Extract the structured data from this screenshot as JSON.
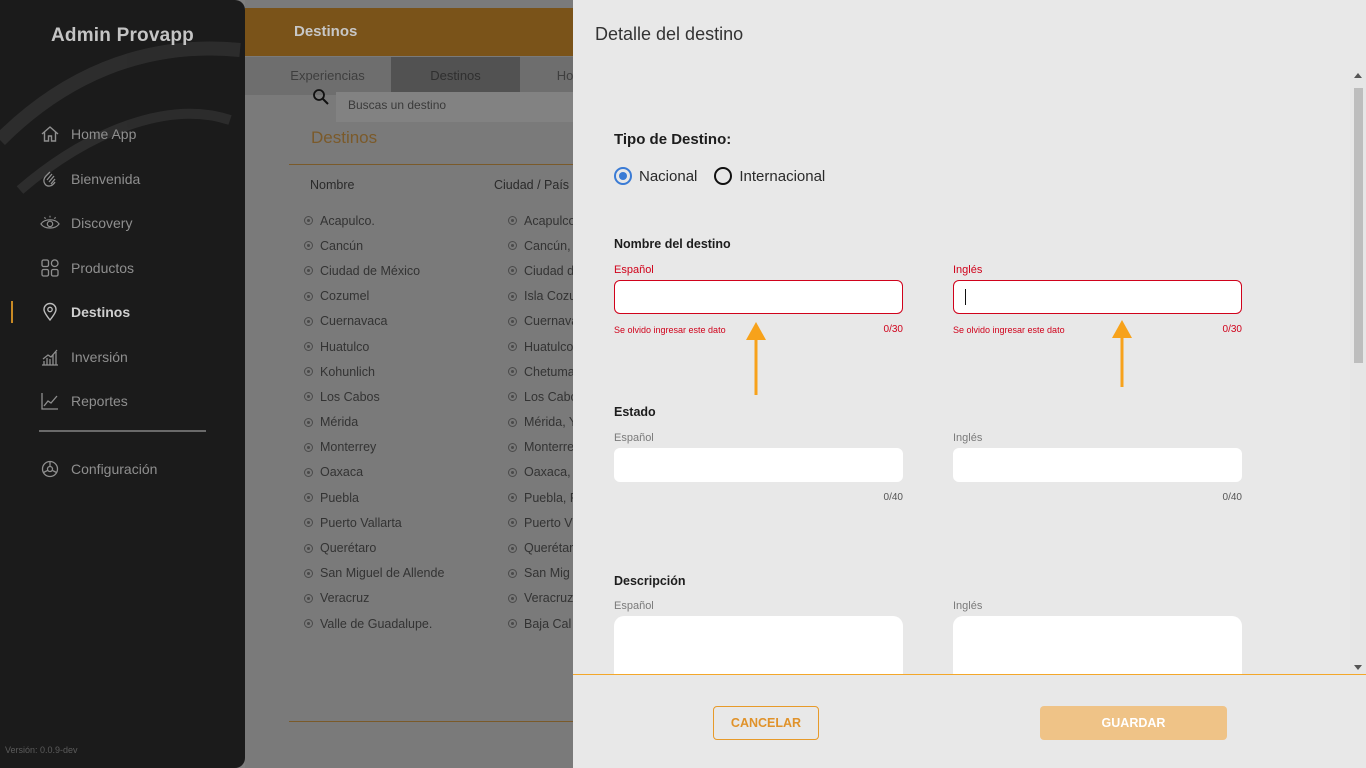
{
  "sidebar": {
    "brand": "Admin Provapp",
    "items": [
      {
        "label": "Home App",
        "icon": "home-icon"
      },
      {
        "label": "Bienvenida",
        "icon": "wave-hand-icon"
      },
      {
        "label": "Discovery",
        "icon": "eye-icon"
      },
      {
        "label": "Productos",
        "icon": "grid-icon"
      },
      {
        "label": "Destinos",
        "icon": "location-pin-icon",
        "active": true
      },
      {
        "label": "Inversión",
        "icon": "bar-chart-icon"
      },
      {
        "label": "Reportes",
        "icon": "line-chart-icon"
      }
    ],
    "config_label": "Configuración",
    "version": "Versión: 0.0.9-dev"
  },
  "background": {
    "header_title": "Destinos",
    "tabs": [
      "Experiencias",
      "Destinos",
      "Ho"
    ],
    "search_placeholder": "Buscas un destino",
    "section_title": "Destinos",
    "columns": [
      "Nombre",
      "Ciudad / País"
    ],
    "rows": [
      {
        "name": "Acapulco.",
        "city": "Acapulco"
      },
      {
        "name": "Cancún",
        "city": "Cancún,"
      },
      {
        "name": "Ciudad de México",
        "city": "Ciudad d"
      },
      {
        "name": "Cozumel",
        "city": "Isla Cozu"
      },
      {
        "name": "Cuernavaca",
        "city": "Cuernava"
      },
      {
        "name": "Huatulco",
        "city": "Huatulco"
      },
      {
        "name": "Kohunlich",
        "city": "Chetuma"
      },
      {
        "name": "Los Cabos",
        "city": "Los Cabo"
      },
      {
        "name": "Mérida",
        "city": "Mérida, Y"
      },
      {
        "name": "Monterrey",
        "city": "Monterre"
      },
      {
        "name": "Oaxaca",
        "city": "Oaxaca,"
      },
      {
        "name": "Puebla",
        "city": "Puebla, P"
      },
      {
        "name": "Puerto Vallarta",
        "city": "Puerto V"
      },
      {
        "name": "Querétaro",
        "city": "Querétar"
      },
      {
        "name": "San Miguel de Allende",
        "city": "San Mig"
      },
      {
        "name": "Veracruz",
        "city": "Veracruz"
      },
      {
        "name": "Valle de Guadalupe.",
        "city": "Baja Cal"
      }
    ]
  },
  "panel": {
    "title": "Detalle del destino",
    "tipo": {
      "title": "Tipo de Destino:",
      "options": [
        "Nacional",
        "Internacional"
      ],
      "selected": "Nacional"
    },
    "nombre": {
      "title": "Nombre del destino",
      "es_label": "Español",
      "en_label": "Inglés",
      "es_value": "",
      "en_value": "",
      "error": "Se olvido ingresar este dato",
      "es_counter": "0/30",
      "en_counter": "0/30"
    },
    "estado": {
      "title": "Estado",
      "es_label": "Español",
      "en_label": "Inglés",
      "es_value": "",
      "en_value": "",
      "es_counter": "0/40",
      "en_counter": "0/40"
    },
    "descripcion": {
      "title": "Descripción",
      "es_label": "Español",
      "en_label": "Inglés"
    },
    "cancel_label": "CANCELAR",
    "save_label": "GUARDAR"
  },
  "colors": {
    "accent": "#f3a72a",
    "error": "#d0021b",
    "radio_selected": "#3a7bd5",
    "annotation_arrow": "#f7a21b"
  }
}
